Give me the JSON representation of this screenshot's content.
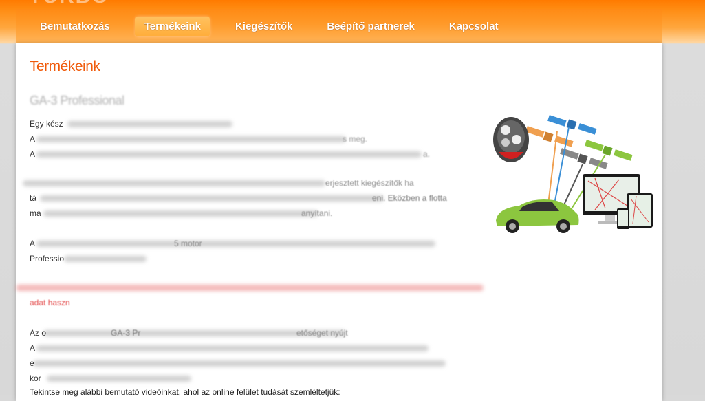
{
  "brand": {
    "fragment": "TURBO"
  },
  "nav": {
    "items": [
      {
        "label": "Bemutatkozás",
        "active": false
      },
      {
        "label": "Termékeink",
        "active": true
      },
      {
        "label": "Kiegészítők",
        "active": false
      },
      {
        "label": "Beépítő partnerek",
        "active": false
      },
      {
        "label": "Kapcsolat",
        "active": false
      }
    ]
  },
  "main": {
    "page_title": "Termékeink",
    "section_title": "GA-3 Professional",
    "paragraphs": [
      [
        "Egy kész",
        "A",
        "A"
      ],
      [
        "",
        "tá",
        "ma"
      ],
      [
        "A",
        "Professio"
      ]
    ],
    "paragraph_tails": [
      [
        "",
        "s meg.",
        "a."
      ],
      [
        "erjesztett kiegészítők ha",
        "eni. Eközben a flotta",
        "anyítani."
      ],
      [
        "5 motor",
        ""
      ]
    ],
    "red_subsection": "adat haszn",
    "paragraph4": {
      "lines": [
        "Az o",
        "A",
        "e",
        "kor"
      ],
      "fragment": "GA-3 Pr",
      "tail": "etőséget nyújt"
    },
    "video_line": "Tekintse meg alábbi bemutató videóinkat, ahol az online felület tudását szemléltetjük:"
  },
  "colors": {
    "accent": "#f05a0a",
    "nav_orange": "#ff8a14",
    "car_green": "#8cc63f"
  },
  "icons": [
    "car-keyfob-icon",
    "satellite-icon",
    "car-icon",
    "monitor-icon",
    "tablet-icon",
    "phone-icon"
  ]
}
